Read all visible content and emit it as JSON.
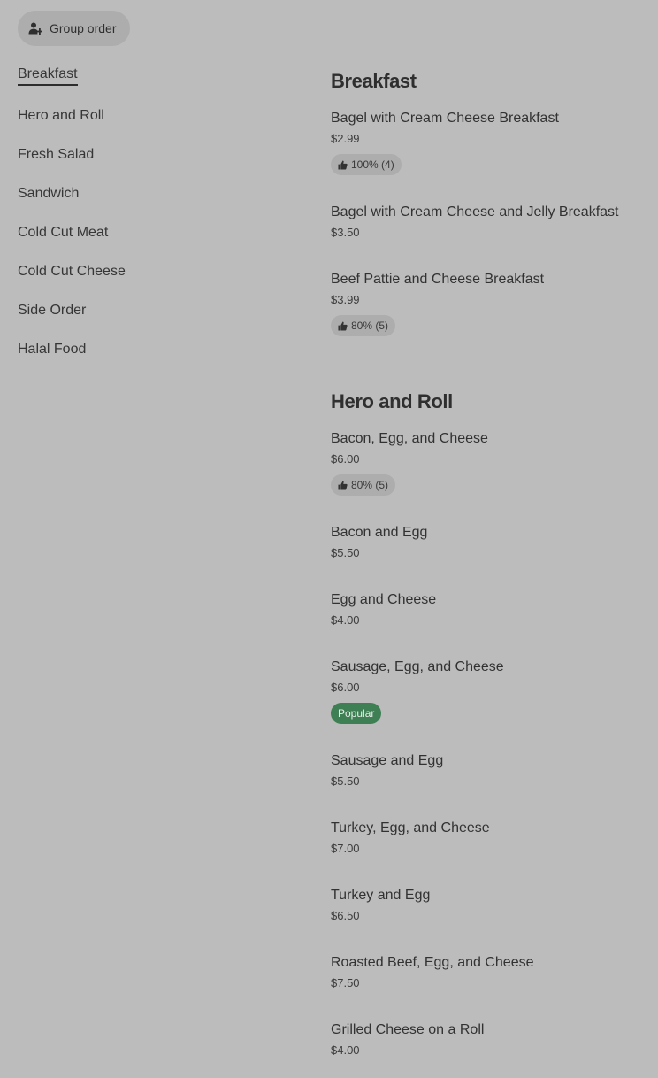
{
  "group_order": {
    "label": "Group order",
    "icon": "add-person-icon"
  },
  "sidebar": {
    "items": [
      {
        "label": "Breakfast",
        "active": true
      },
      {
        "label": "Hero and Roll"
      },
      {
        "label": "Fresh Salad"
      },
      {
        "label": "Sandwich"
      },
      {
        "label": "Cold Cut Meat"
      },
      {
        "label": "Cold Cut Cheese"
      },
      {
        "label": "Side Order"
      },
      {
        "label": "Halal Food"
      }
    ]
  },
  "sections": [
    {
      "title": "Breakfast",
      "items": [
        {
          "name": "Bagel with Cream Cheese Breakfast",
          "price": "$2.99",
          "rating": "100% (4)"
        },
        {
          "name": "Bagel with Cream Cheese and Jelly Breakfast",
          "price": "$3.50"
        },
        {
          "name": "Beef Pattie and Cheese Breakfast",
          "price": "$3.99",
          "rating": "80% (5)"
        }
      ]
    },
    {
      "title": "Hero and Roll",
      "items": [
        {
          "name": "Bacon, Egg, and Cheese",
          "price": "$6.00",
          "rating": "80% (5)"
        },
        {
          "name": "Bacon and Egg",
          "price": "$5.50"
        },
        {
          "name": "Egg and Cheese",
          "price": "$4.00"
        },
        {
          "name": "Sausage, Egg, and Cheese",
          "price": "$6.00",
          "tag": "Popular"
        },
        {
          "name": "Sausage and Egg",
          "price": "$5.50"
        },
        {
          "name": "Turkey, Egg, and Cheese",
          "price": "$7.00"
        },
        {
          "name": "Turkey and Egg",
          "price": "$6.50"
        },
        {
          "name": "Roasted Beef, Egg, and Cheese",
          "price": "$7.50"
        },
        {
          "name": "Grilled Cheese on a Roll",
          "price": "$4.00"
        }
      ]
    }
  ],
  "colors": {
    "background": "#bcbcbc",
    "popular_badge": "#3e7f54",
    "chip": "#adadad"
  }
}
